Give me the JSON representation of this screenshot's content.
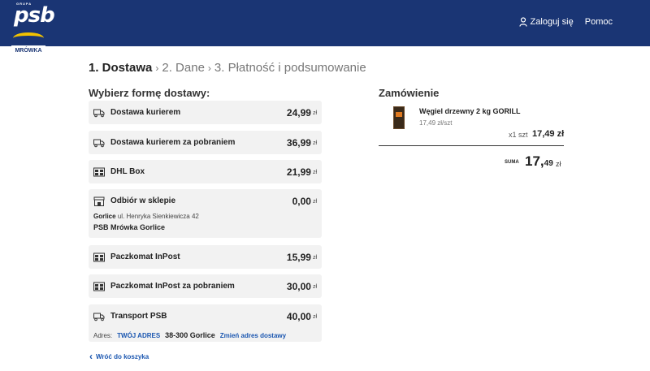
{
  "header": {
    "logo": {
      "top": "GRUPA",
      "brand": "psb",
      "sub": "MRÓWKA"
    },
    "login": "Zaloguj się",
    "help": "Pomoc"
  },
  "steps": {
    "step1": "1. Dostawa",
    "step2": "2. Dane",
    "step3": "3. Płatność i podsumowanie"
  },
  "delivery": {
    "title": "Wybierz formę dostawy:",
    "currency": "zł",
    "options": [
      {
        "label": "Dostawa kurierem",
        "price": "24,99",
        "icon": "truck-icon"
      },
      {
        "label": "Dostawa kurierem za pobraniem",
        "price": "36,99",
        "icon": "truck-icon"
      },
      {
        "label": "DHL Box",
        "price": "21,99",
        "icon": "locker-icon"
      },
      {
        "label": "Odbiór w sklepie",
        "price": "0,00",
        "icon": "store-icon"
      },
      {
        "label": "Paczkomat InPost",
        "price": "15,99",
        "icon": "locker-icon"
      },
      {
        "label": "Paczkomat InPost za pobraniem",
        "price": "30,00",
        "icon": "locker-icon"
      },
      {
        "label": "Transport PSB",
        "price": "40,00",
        "icon": "truck-icon"
      }
    ],
    "store": {
      "city": "Gorlice",
      "street": "ul. Henryka Sienkiewicza 42",
      "name": "PSB Mrówka Gorlice"
    },
    "address": {
      "label": "Adres:",
      "tag": "TWÓJ ADRES",
      "city": "38-300 Gorlice",
      "change": "Zmień adres dostawy"
    }
  },
  "back": "Wróć do koszyka",
  "order": {
    "title": "Zamówienie",
    "product": {
      "name": "Węgiel drzewny 2 kg GORILL",
      "unit_price": "17,49 zł/szt",
      "qty": "x1 szt",
      "total": "17,49 zł"
    },
    "sum_label": "SUMA",
    "sum_int": "17,",
    "sum_dec": "49",
    "sum_cur": "zł"
  }
}
